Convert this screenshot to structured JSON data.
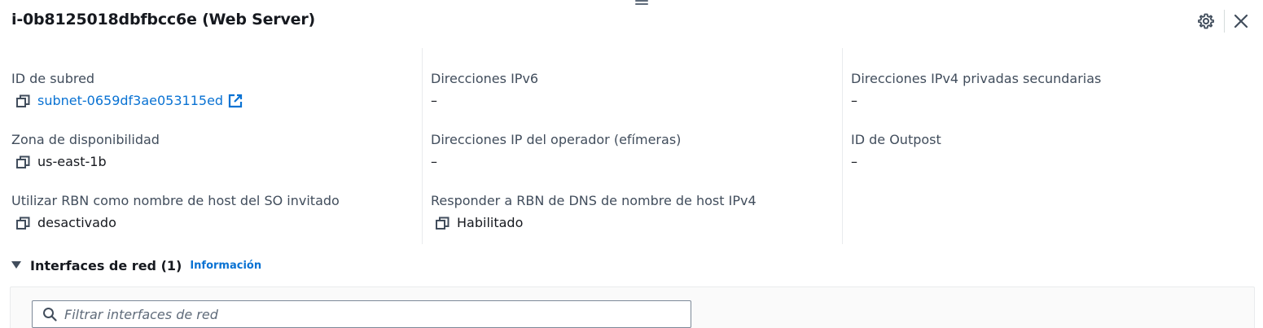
{
  "header": {
    "title": "i-0b8125018dbfbcc6e (Web Server)"
  },
  "columns": [
    {
      "fields": [
        {
          "label": "ID de subred",
          "value": "subnet-0659df3ae053115ed",
          "copyable": true,
          "link": true,
          "external": true
        },
        {
          "label": "Zona de disponibilidad",
          "value": "us-east-1b",
          "copyable": true
        },
        {
          "label": "Utilizar RBN como nombre de host del SO invitado",
          "value": "desactivado",
          "copyable": true
        }
      ]
    },
    {
      "fields": [
        {
          "label": "Direcciones IPv6",
          "value": "–"
        },
        {
          "label": "Direcciones IP del operador (efímeras)",
          "value": "–"
        },
        {
          "label": "Responder a RBN de DNS de nombre de host IPv4",
          "value": "Habilitado",
          "copyable": true
        }
      ]
    },
    {
      "fields": [
        {
          "label": "Direcciones IPv4 privadas secundarias",
          "value": "–"
        },
        {
          "label": "ID de Outpost",
          "value": "–"
        }
      ]
    }
  ],
  "network_interfaces": {
    "title": "Interfaces de red (1)",
    "info_link": "Información",
    "filter_placeholder": "Filtrar interfaces de red",
    "filter_value": ""
  },
  "colors": {
    "link": "#0972d3",
    "text": "#16191f",
    "label": "#414d5c"
  }
}
